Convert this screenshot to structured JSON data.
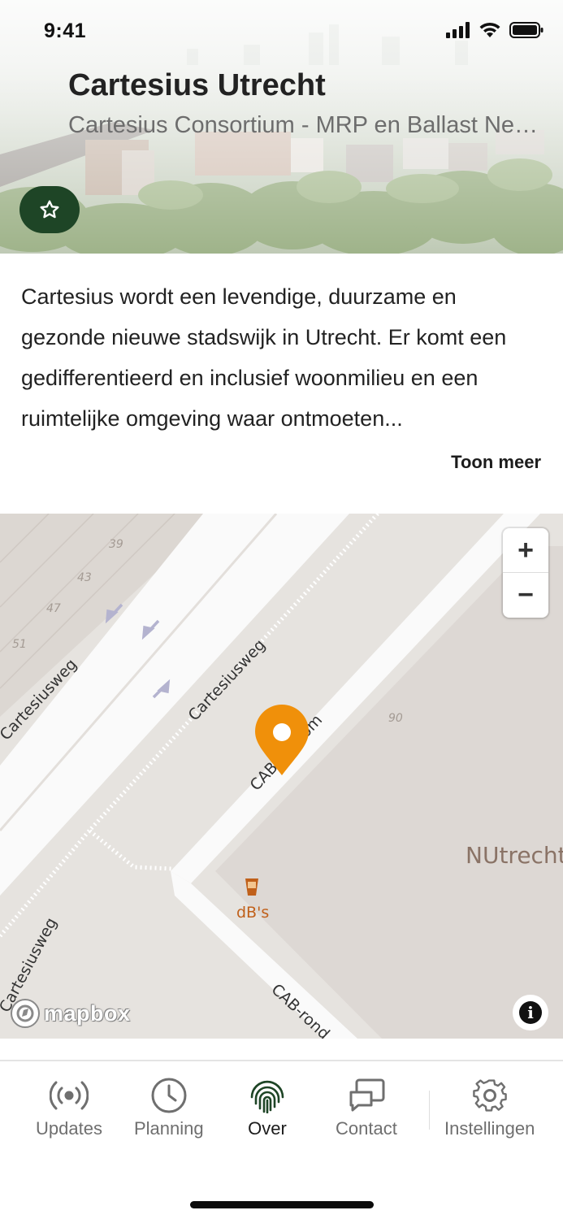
{
  "status_bar": {
    "time": "9:41"
  },
  "hero": {
    "title": "Cartesius Utrecht",
    "subtitle": "Cartesius Consortium - MRP en Ballast Nedam"
  },
  "description": {
    "text": "Cartesius wordt een levendige, duurzame en gezonde nieuwe stadswijk in Utrecht. Er komt een gedifferentieerd en inclusief woonmilieu en een ruimtelijke omgeving waar ontmoeten...",
    "show_more": "Toon meer"
  },
  "map": {
    "street_labels": [
      "Cartesiusweg",
      "Cartesiusweg",
      "Cartesiusweg",
      "CAB-rondom",
      "CAB-rond"
    ],
    "house_numbers": [
      "39",
      "43",
      "47",
      "51",
      "90"
    ],
    "area_label": "NUtrecht",
    "poi_label": "dB's",
    "zoom_in": "+",
    "zoom_out": "−",
    "attribution_logo": "mapbox",
    "info": "i",
    "marker_color": "#F0900A"
  },
  "tabs": [
    {
      "label": "Updates",
      "icon": "broadcast-icon",
      "active": false
    },
    {
      "label": "Planning",
      "icon": "clock-icon",
      "active": false
    },
    {
      "label": "Over",
      "icon": "fingerprint-icon",
      "active": true
    },
    {
      "label": "Contact",
      "icon": "chat-screen-icon",
      "active": false
    },
    {
      "label": "Instellingen",
      "icon": "gear-icon",
      "active": false
    }
  ],
  "colors": {
    "accent_dark_green": "#1E4526",
    "marker_orange": "#F0900A",
    "poi_brown": "#C0601A"
  }
}
